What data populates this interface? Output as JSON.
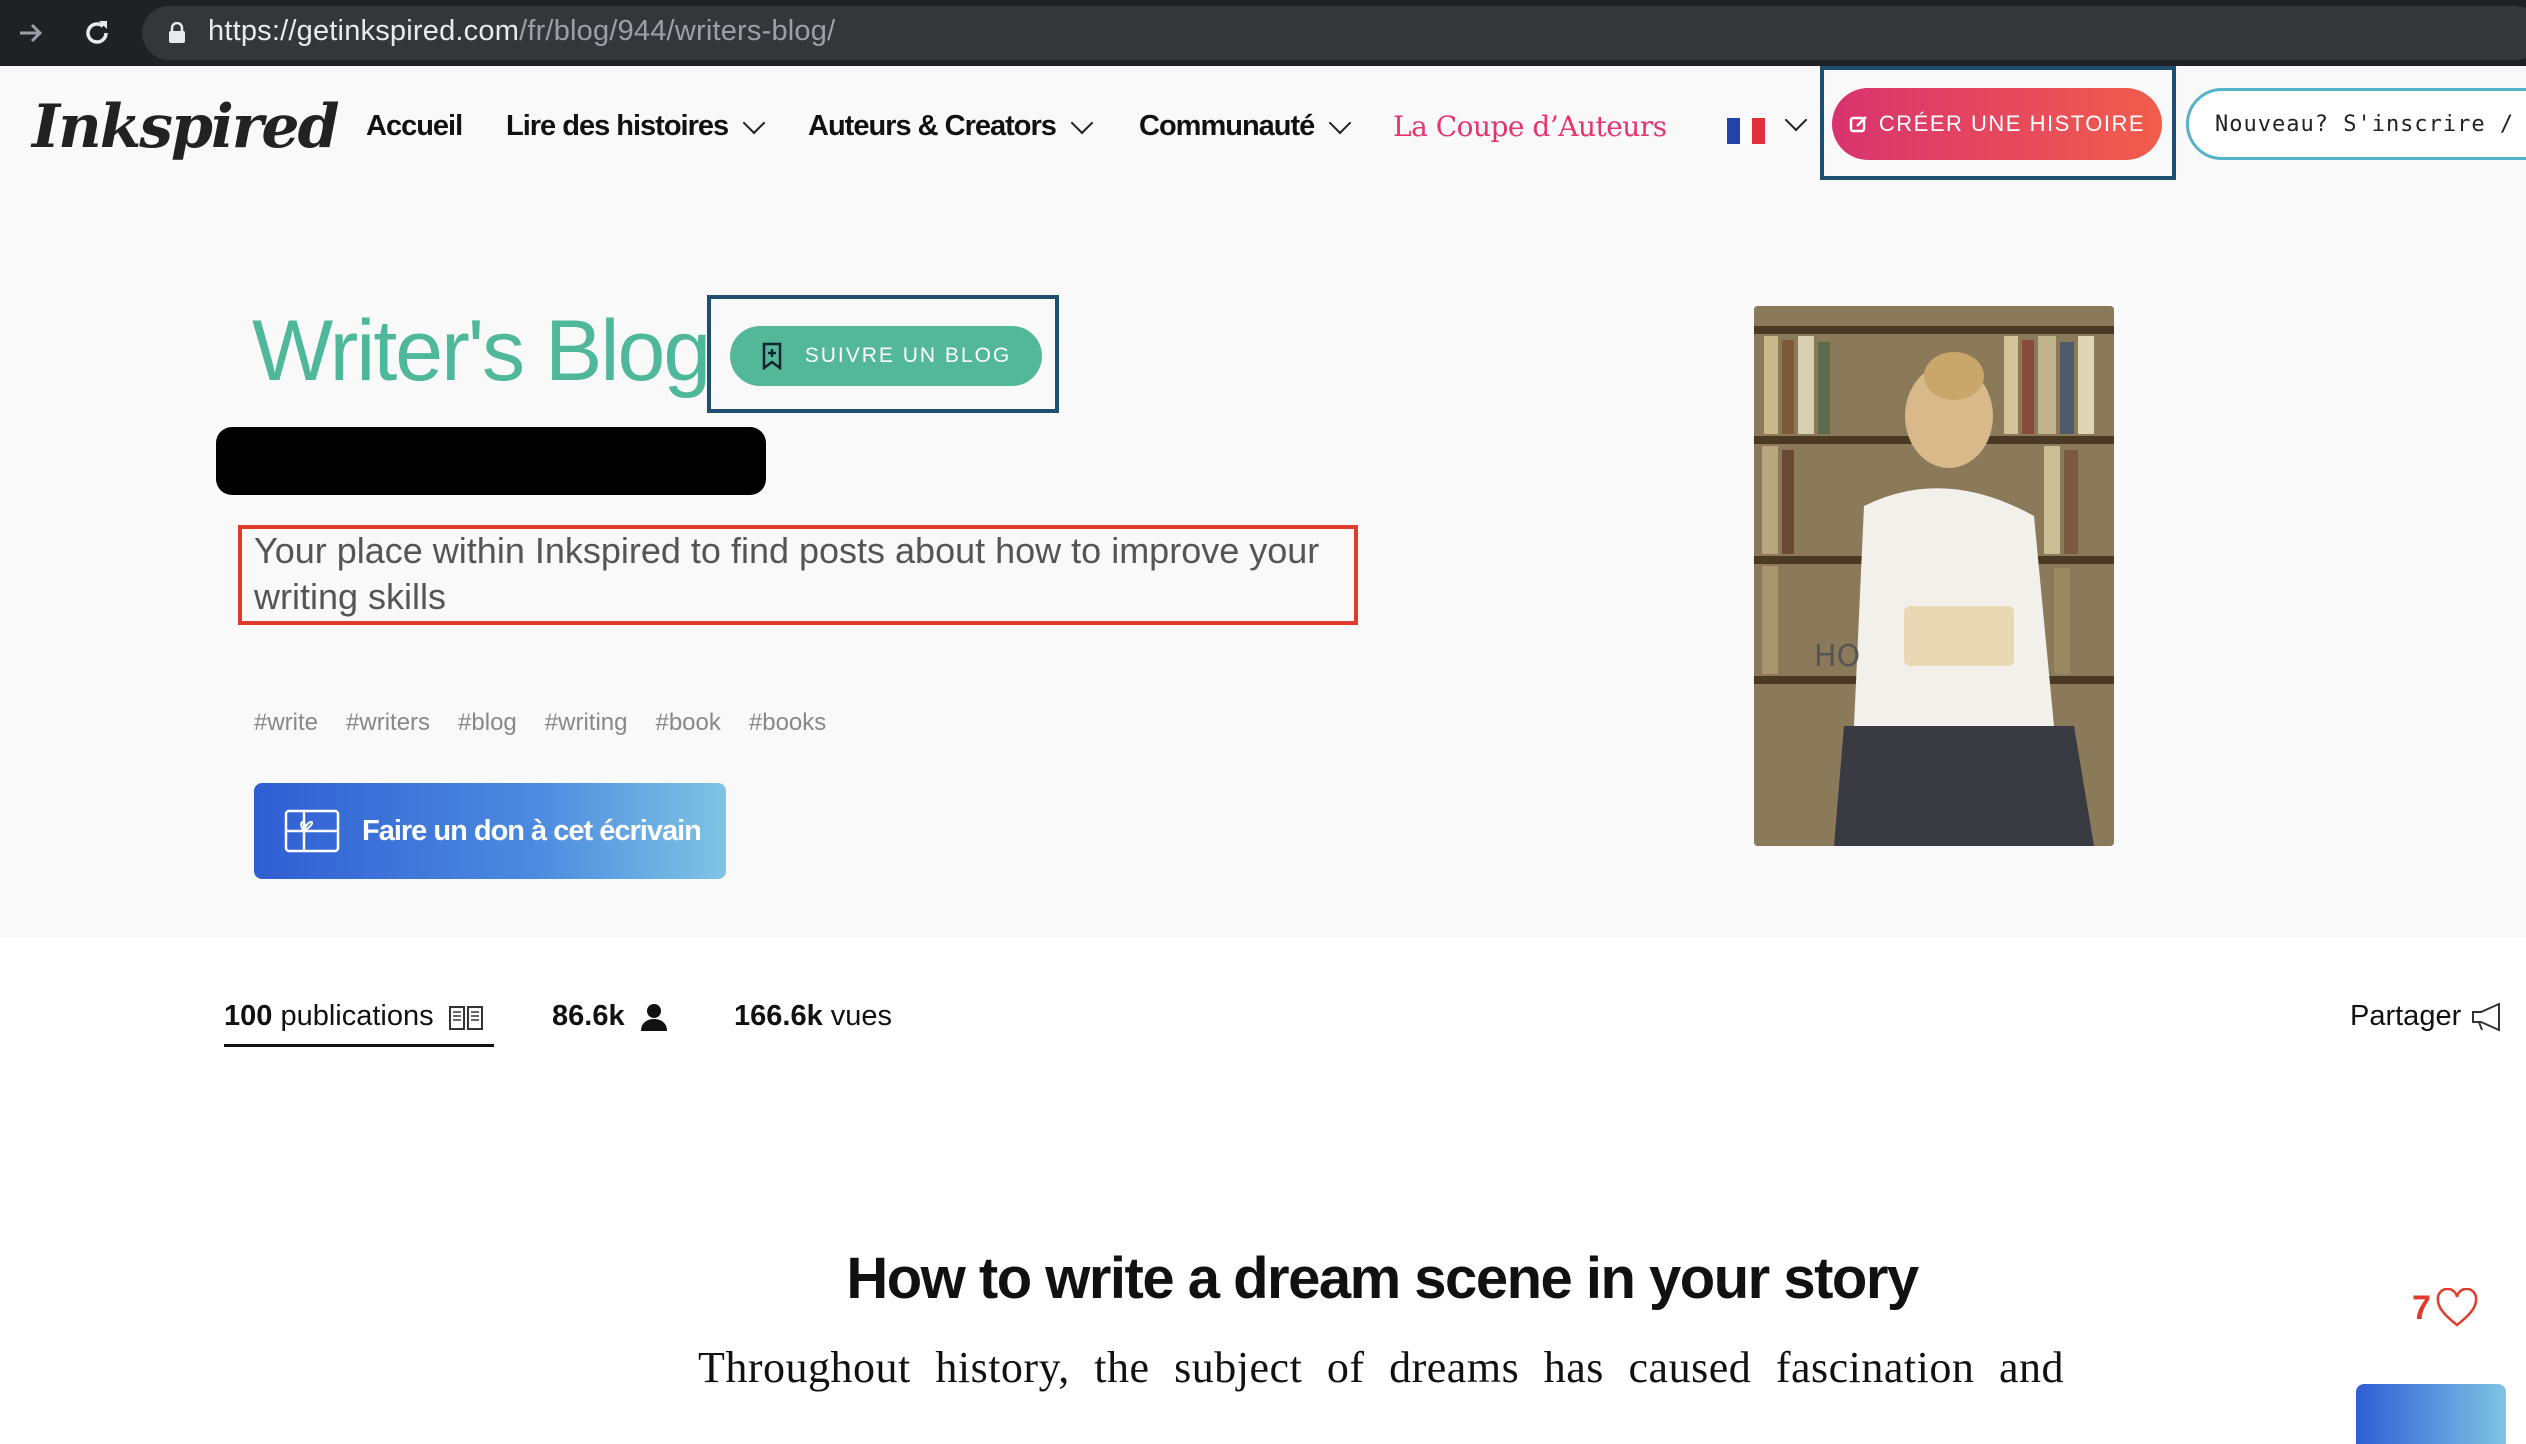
{
  "browser": {
    "url_host": "https://getinkspired.com",
    "url_path": "/fr/blog/944/writers-blog/"
  },
  "header": {
    "logo": "Inkspired",
    "nav": [
      {
        "label": "Accueil"
      },
      {
        "label": "Lire des histoires"
      },
      {
        "label": "Auteurs & Creators"
      },
      {
        "label": "Communauté"
      },
      {
        "label": "La Coupe d’Auteurs"
      }
    ],
    "create_label": "CRÉER UNE HISTOIRE",
    "signup_label": "Nouveau? S'inscrire / Se Connecter"
  },
  "hero": {
    "title": "Writer's Blog",
    "follow_label": "SUIVRE UN BLOG",
    "description": "Your place within Inkspired to find posts about how to improve your writing skills",
    "tags": [
      "#write",
      "#writers",
      "#blog",
      "#writing",
      "#book",
      "#books"
    ],
    "donate_label": "Faire un don à cet écrivain"
  },
  "stats": {
    "publications_count": "100",
    "publications_label": "publications",
    "followers_count": "86.6k",
    "views_count": "166.6k",
    "views_label": "vues",
    "share_label": "Partager"
  },
  "article": {
    "title": "How to write a dream scene in your story",
    "body_first_line": "Throughout history, the subject of dreams has caused fascination and",
    "likes": "7"
  },
  "colors": {
    "accent_green": "#4fb89a",
    "accent_pink": "#e6356e",
    "annotation_blue": "#1f4f6e",
    "annotation_red": "#e13b2b"
  }
}
